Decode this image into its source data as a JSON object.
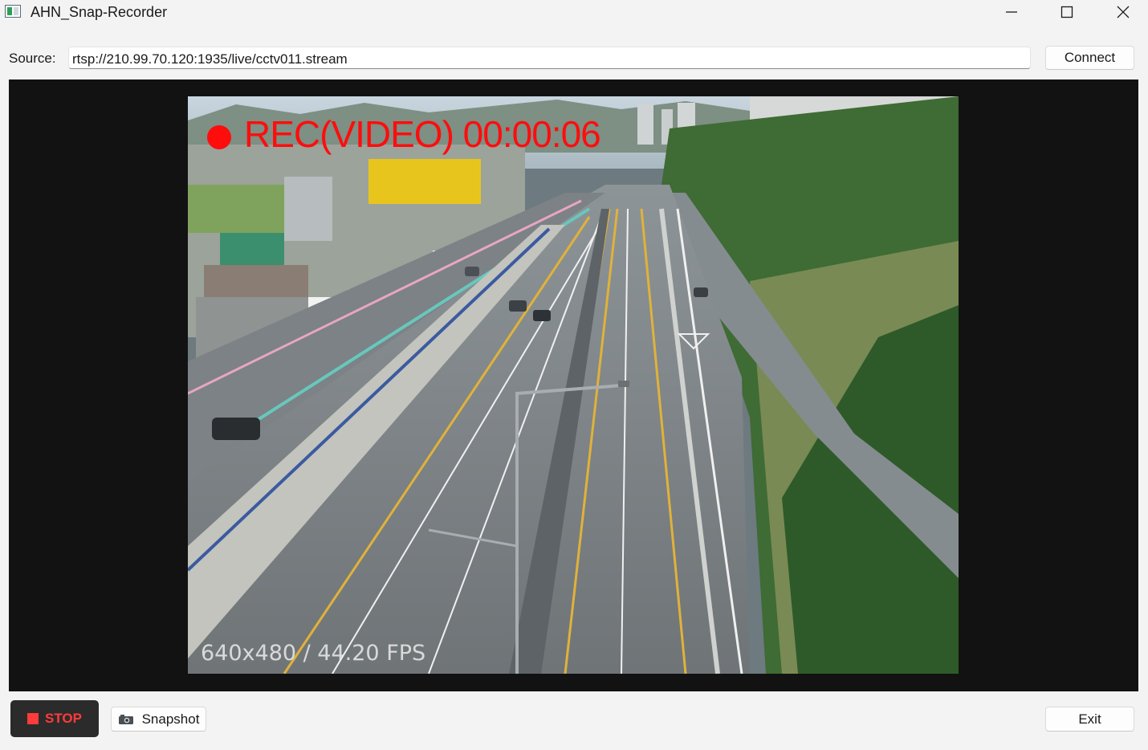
{
  "window": {
    "title": "AHN_Snap-Recorder",
    "icons": [
      "app-icon",
      "minimize-icon",
      "maximize-icon",
      "close-icon"
    ]
  },
  "source": {
    "label": "Source:",
    "value": "rtsp://210.99.70.120:1935/live/cctv011.stream",
    "connect_label": "Connect"
  },
  "video": {
    "rec_text": "REC(VIDEO) 00:00:06",
    "stats_text": "640x480 / 44.20 FPS",
    "rec_color": "#ff0d0d"
  },
  "controls": {
    "stop_label": "STOP",
    "snapshot_label": "Snapshot",
    "snapshot_icon": "camera-icon",
    "exit_label": "Exit"
  }
}
